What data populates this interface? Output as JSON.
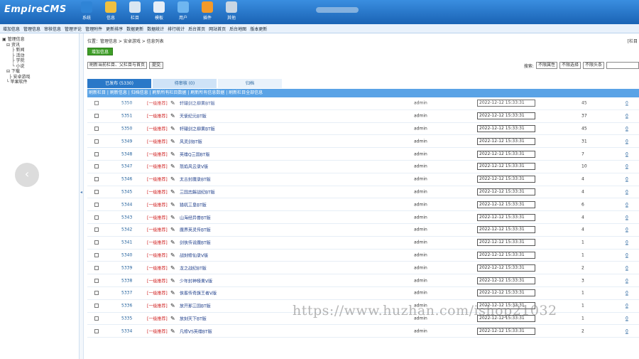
{
  "header": {
    "logo": "EmpireCMS",
    "nav": [
      {
        "label": "系统",
        "icon": "globe-icon",
        "color": "#2f84d6"
      },
      {
        "label": "信息",
        "icon": "edit-icon",
        "color": "#f0c040"
      },
      {
        "label": "栏目",
        "icon": "folder-icon",
        "color": "#d9e6f2"
      },
      {
        "label": "模板",
        "icon": "template-icon",
        "color": "#e6eef7"
      },
      {
        "label": "用户",
        "icon": "user-icon",
        "color": "#6fb6f0"
      },
      {
        "label": "插件",
        "icon": "plugin-icon",
        "color": "#f39a2a"
      },
      {
        "label": "其他",
        "icon": "gear-icon",
        "color": "#c9d6e3"
      }
    ]
  },
  "menubar": [
    "增加信息",
    "管理信息",
    "审核信息",
    "管理评论",
    "管理附件",
    "更新排序",
    "数据更新",
    "数据统计",
    "排行统计",
    "后台首页",
    "网站首页",
    "后台地图",
    "版本更新"
  ],
  "sidebar": {
    "tree": [
      "管理信息",
      "资讯",
      "新闻",
      "活动",
      "学院",
      "小说",
      "下载",
      "安卓游戏",
      "苹果软件"
    ],
    "back_glyph": "‹",
    "toggle_glyph": "◂"
  },
  "main": {
    "breadcrumb": "位置：管理信息 > 安卓游戏 > 信息列表",
    "breadcrumb_right": "[栏目",
    "add_button": "增加信息",
    "filter_select": "刷新当前栏目、父栏目与首页",
    "filter_button": "提交",
    "search_label": "搜索:",
    "search_selects": [
      "不限属性",
      "不限选择",
      "不限头条"
    ],
    "tabs": [
      "已发布 (5330)",
      "待审核 (0)",
      "归档"
    ],
    "subbar": "刷新栏目 | 刷新信息 | 归档信息 | 刷新所有栏目数据 | 刷新所有信息数据 | 刷新栏目全部信息"
  },
  "rows": [
    {
      "id": "5350",
      "cat": "[一级推荐]",
      "title": "轩辕剑之柳黄BT版",
      "user": "admin",
      "date": "2022-12-12 15:33:31",
      "views": "45",
      "act": "0",
      "ghost": true
    },
    {
      "id": "5351",
      "cat": "[一级推荐]",
      "title": "天使纪元BT版",
      "user": "admin",
      "date": "2022-12-12 15:33:31",
      "views": "37",
      "act": "0"
    },
    {
      "id": "5350",
      "cat": "[一级推荐]",
      "title": "轩辕剑之柳黄BT版",
      "user": "admin",
      "date": "2022-12-12 15:33:31",
      "views": "45",
      "act": "0"
    },
    {
      "id": "5349",
      "cat": "[一级推荐]",
      "title": "风灵剑BT版",
      "user": "admin",
      "date": "2022-12-12 15:33:31",
      "views": "31",
      "act": "0"
    },
    {
      "id": "5348",
      "cat": "[一级推荐]",
      "title": "英雄Q三国BT版",
      "user": "admin",
      "date": "2022-12-12 15:33:31",
      "views": "7",
      "act": "0"
    },
    {
      "id": "5347",
      "cat": "[一级推荐]",
      "title": "怒焰风云录V版",
      "user": "admin",
      "date": "2022-12-12 15:33:31",
      "views": "10",
      "act": "0"
    },
    {
      "id": "5346",
      "cat": "[一级推荐]",
      "title": "太古封魔录BT版",
      "user": "admin",
      "date": "2022-12-12 15:33:31",
      "views": "4",
      "act": "0"
    },
    {
      "id": "5345",
      "cat": "[一级推荐]",
      "title": "三国志解战纪BT版",
      "user": "admin",
      "date": "2022-12-12 15:33:31",
      "views": "4",
      "act": "0"
    },
    {
      "id": "5344",
      "cat": "[一级推荐]",
      "title": "猎杌三皇BT版",
      "user": "admin",
      "date": "2022-12-12 15:33:31",
      "views": "6",
      "act": "0"
    },
    {
      "id": "5343",
      "cat": "[一级推荐]",
      "title": "山海经异兽BT版",
      "user": "admin",
      "date": "2022-12-12 15:33:31",
      "views": "4",
      "act": "0"
    },
    {
      "id": "5342",
      "cat": "[一级推荐]",
      "title": "魔界英灵传BT版",
      "user": "admin",
      "date": "2022-12-12 15:33:31",
      "views": "4",
      "act": "0"
    },
    {
      "id": "5341",
      "cat": "[一级推荐]",
      "title": "剑侠传说魔BT版",
      "user": "admin",
      "date": "2022-12-12 15:33:31",
      "views": "1",
      "act": "0"
    },
    {
      "id": "5340",
      "cat": "[一级推荐]",
      "title": "战刻修仙录V版",
      "user": "admin",
      "date": "2022-12-12 15:33:31",
      "views": "1",
      "act": "0"
    },
    {
      "id": "5339",
      "cat": "[一级推荐]",
      "title": "龙之战纪BT版",
      "user": "admin",
      "date": "2022-12-12 15:33:31",
      "views": "2",
      "act": "0"
    },
    {
      "id": "5338",
      "cat": "[一级推荐]",
      "title": "少年封神榜果V版",
      "user": "admin",
      "date": "2022-12-12 15:33:31",
      "views": "3",
      "act": "0"
    },
    {
      "id": "5337",
      "cat": "[一级推荐]",
      "title": "侠客传奇旗王者V版",
      "user": "admin",
      "date": "2022-12-12 15:33:31",
      "views": "1",
      "act": "0"
    },
    {
      "id": "5336",
      "cat": "[一级推荐]",
      "title": "放开那三国BT版",
      "user": "admin",
      "date": "2022-12-12 15:33:31",
      "views": "1",
      "act": "0"
    },
    {
      "id": "5335",
      "cat": "[一级推荐]",
      "title": "放刻天下BT版",
      "user": "admin",
      "date": "2022-12-12 15:33:31",
      "views": "1",
      "act": "0"
    },
    {
      "id": "5334",
      "cat": "[一级推荐]",
      "title": "凡修VS英雄BT版",
      "user": "admin",
      "date": "2022-12-12 15:33:31",
      "views": "2",
      "act": "0"
    }
  ],
  "watermark": "https://www.huzhan.com/ishop21032"
}
